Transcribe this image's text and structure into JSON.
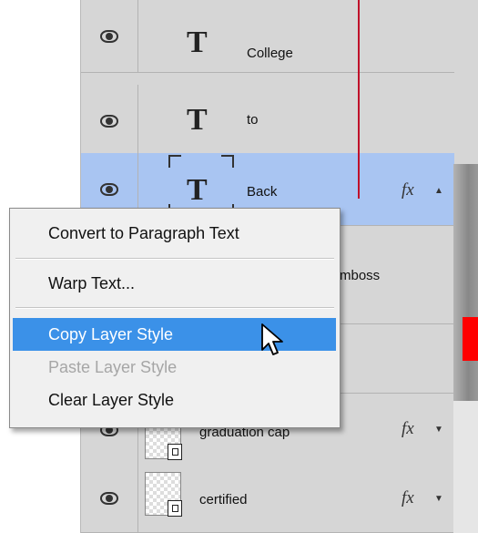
{
  "layers": [
    {
      "name": "College",
      "type": "text",
      "thumb": "T"
    },
    {
      "name": "to",
      "type": "text",
      "thumb": "T"
    },
    {
      "name": "Back",
      "type": "text",
      "thumb": "T",
      "selected": true,
      "fx": "fx"
    },
    {
      "name": "mboss"
    },
    {
      "name": "graduation cap",
      "type": "smart-object",
      "fx": "fx"
    },
    {
      "name": "certified",
      "type": "smart-object",
      "fx": "fx"
    }
  ],
  "context_menu": {
    "items": [
      {
        "label": "Convert to Paragraph Text",
        "state": "normal"
      },
      {
        "label": "Warp Text...",
        "state": "normal"
      },
      {
        "label": "Copy Layer Style",
        "state": "highlighted"
      },
      {
        "label": "Paste Layer Style",
        "state": "disabled"
      },
      {
        "label": "Clear Layer Style",
        "state": "normal"
      }
    ]
  },
  "colors": {
    "selected_row": "#a9c5f2",
    "menu_highlight": "#3b91e8",
    "marker_red": "#ff0000"
  },
  "icons": [
    "eye-icon",
    "text-layer-icon",
    "smart-object-icon",
    "fx-icon",
    "collapse-arrow-icon",
    "expand-arrow-icon",
    "mouse-pointer-icon"
  ]
}
